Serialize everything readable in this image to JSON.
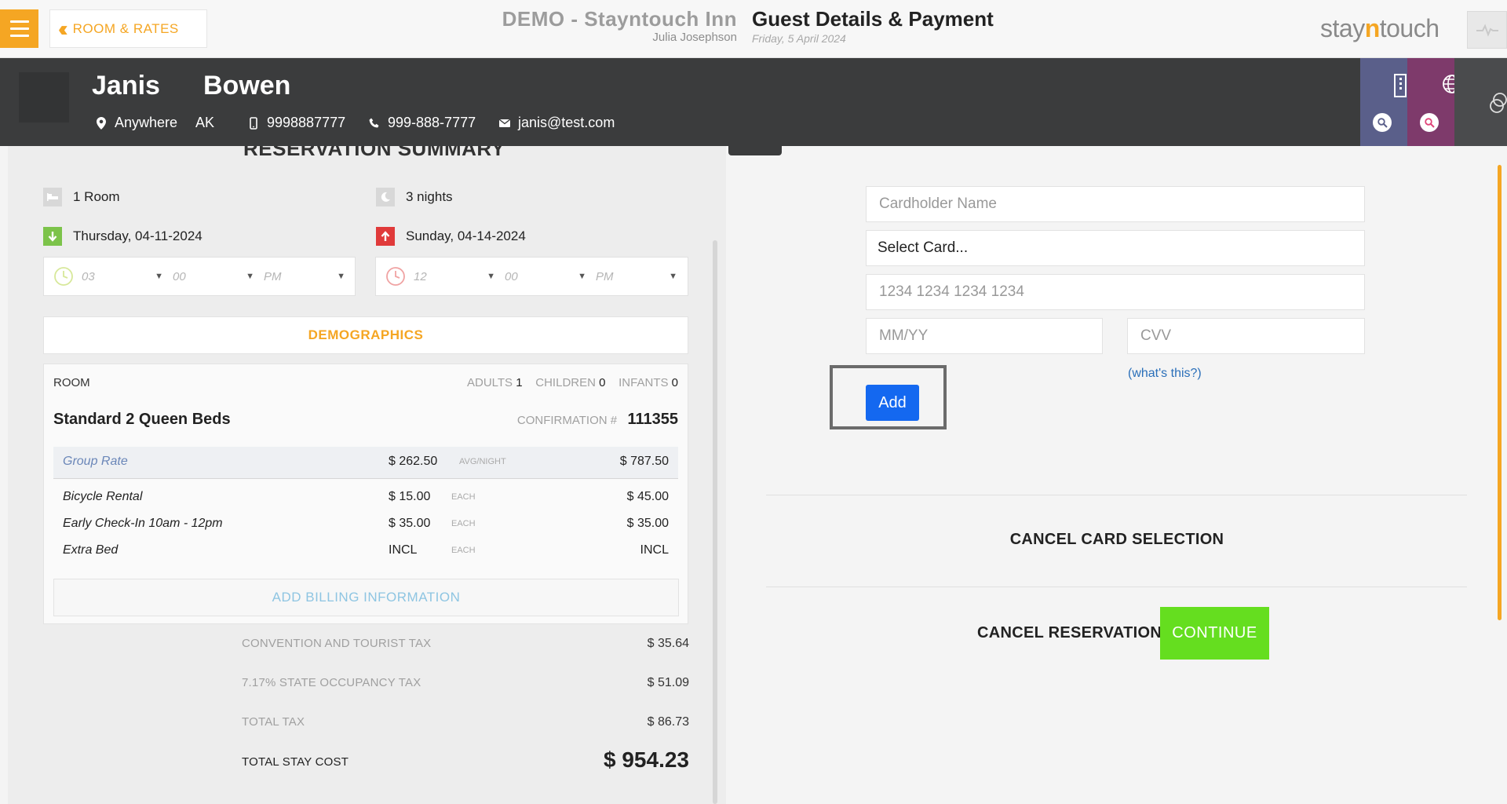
{
  "header": {
    "back_label": "ROOM & RATES",
    "hotel_name": "DEMO - Stayntouch Inn",
    "user_name": "Julia Josephson",
    "page_title": "Guest Details & Payment",
    "business_date": "Friday, 5 April 2024",
    "logo_part1": "stay",
    "logo_part2": "n",
    "logo_part3": "touch"
  },
  "guest": {
    "first_name": "Janis",
    "last_name": "Bowen",
    "city": "Anywhere",
    "state": "AK",
    "mobile": "9998887777",
    "phone": "999-888-7777",
    "email": "janis@test.com"
  },
  "reservation": {
    "title": "RESERVATION SUMMARY",
    "rooms": "1 Room",
    "nights": "3 nights",
    "arrival_date": "Thursday, 04-11-2024",
    "departure_date": "Sunday, 04-14-2024",
    "arrival_time": {
      "hour": "03",
      "minute": "00",
      "ampm": "PM"
    },
    "departure_time": {
      "hour": "12",
      "minute": "00",
      "ampm": "PM"
    },
    "demographics_label": "DEMOGRAPHICS",
    "room_label": "ROOM",
    "adults_label": "ADULTS",
    "adults": "1",
    "children_label": "CHILDREN",
    "children": "0",
    "infants_label": "INFANTS",
    "infants": "0",
    "room_type": "Standard 2 Queen Beds",
    "confirmation_label": "CONFIRMATION #",
    "confirmation_number": "111355",
    "rate": {
      "name": "Group Rate",
      "price": "$ 262.50",
      "unit": "AVG/NIGHT",
      "total": "$ 787.50"
    },
    "addons": [
      {
        "name": "Bicycle Rental",
        "price": "$ 15.00",
        "unit": "EACH",
        "total": "$ 45.00"
      },
      {
        "name": "Early Check-In 10am - 12pm",
        "price": "$ 35.00",
        "unit": "EACH",
        "total": "$ 35.00"
      },
      {
        "name": "Extra Bed",
        "price": "INCL",
        "unit": "EACH",
        "total": "INCL"
      }
    ],
    "add_billing_label": "ADD BILLING INFORMATION",
    "taxes": [
      {
        "label": "CONVENTION AND TOURIST TAX",
        "value": "$ 35.64"
      },
      {
        "label": "7.17% STATE OCCUPANCY TAX",
        "value": "$ 51.09"
      },
      {
        "label": "TOTAL TAX",
        "value": "$ 86.73"
      }
    ],
    "total_label": "TOTAL STAY COST",
    "total_value": "$ 954.23"
  },
  "payment": {
    "cardholder_placeholder": "Cardholder Name",
    "select_card": "Select Card...",
    "card_number_placeholder": "1234 1234 1234 1234",
    "expiry_placeholder": "MM/YY",
    "cvv_placeholder": "CVV",
    "whats_this": "(what's this?)",
    "add_label": "Add",
    "cancel_card_label": "CANCEL CARD SELECTION",
    "cancel_reservation_label": "CANCEL RESERVATION",
    "continue_label": "CONTINUE"
  },
  "icons": [
    "menu-icon",
    "double-chevron-left-icon",
    "pulse-icon",
    "location-pin-icon",
    "mobile-icon",
    "phone-icon",
    "envelope-icon",
    "building-icon",
    "globe-icon",
    "search-icon",
    "bed-icon",
    "moon-icon",
    "arrival-arrow-icon",
    "departure-arrow-icon",
    "clock-icon",
    "caret-down-icon"
  ],
  "colors": {
    "accent": "#f5a623",
    "guest_bar": "#3b3c3d",
    "add_button": "#1468f0",
    "continue_button": "#65de1f",
    "arrival": "#7cc34a",
    "departure": "#e03a3a"
  }
}
